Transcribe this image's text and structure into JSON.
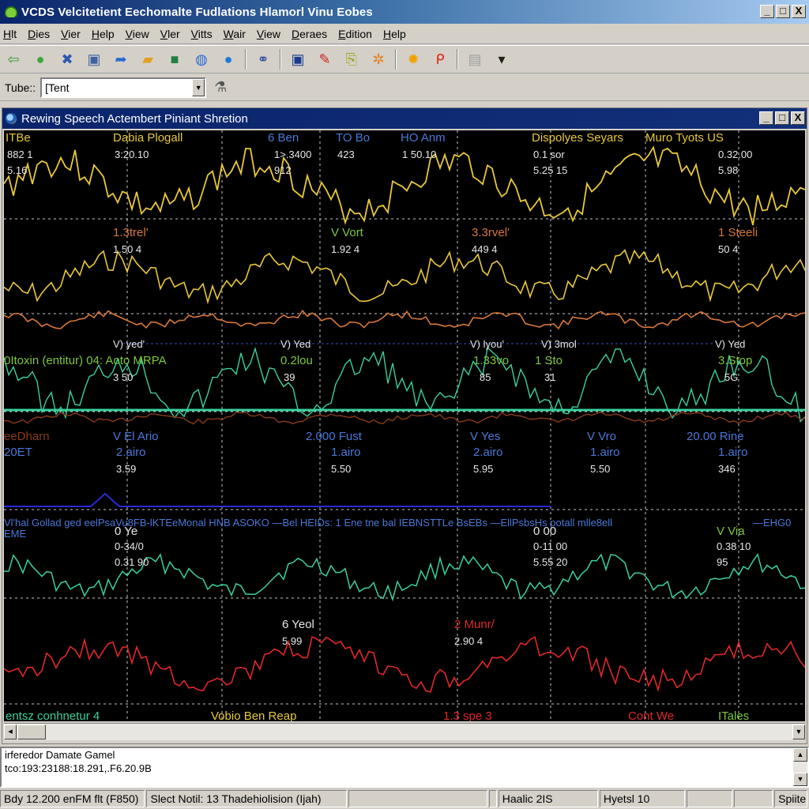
{
  "window": {
    "title": "VCDS  Velcitetient Eechomalte Fudlations Hlamorl Vinu Eobes",
    "controls": [
      "_",
      "□",
      "X"
    ]
  },
  "menubar": {
    "items": [
      "Hlt",
      "Dies",
      "Vier",
      "Help",
      "View",
      "Vler",
      "Vitts",
      "Wair",
      "View",
      "Deraes",
      "Edition",
      "Help"
    ]
  },
  "toolbar": {
    "buttons": [
      {
        "name": "back-arrow-icon",
        "glyph": "⇦",
        "color": "#3a9a3a"
      },
      {
        "name": "green-circle-icon",
        "glyph": "●",
        "color": "#3aa83a"
      },
      {
        "name": "tools-icon",
        "glyph": "✖",
        "color": "#2a5ab0"
      },
      {
        "name": "clipboard-icon",
        "glyph": "▣",
        "color": "#4060a0"
      },
      {
        "name": "pin-icon",
        "glyph": "➦",
        "color": "#2a6ad0"
      },
      {
        "name": "folder-icon",
        "glyph": "▰",
        "color": "#e0a020"
      },
      {
        "name": "monitor-icon",
        "glyph": "■",
        "color": "#208040"
      },
      {
        "name": "globe-icon",
        "glyph": "◍",
        "color": "#2a6ad0"
      },
      {
        "name": "blue-circle-icon",
        "glyph": "●",
        "color": "#1a7ad8"
      },
      {
        "name": "sep",
        "glyph": "",
        "color": ""
      },
      {
        "name": "link-icon",
        "glyph": "⚭",
        "color": "#3050a0"
      },
      {
        "name": "sep",
        "glyph": "",
        "color": ""
      },
      {
        "name": "document-icon",
        "glyph": "▣",
        "color": "#1a3a90"
      },
      {
        "name": "pen-icon",
        "glyph": "✎",
        "color": "#d02020"
      },
      {
        "name": "file-export-icon",
        "glyph": "⎘",
        "color": "#a0a020"
      },
      {
        "name": "gear-icon",
        "glyph": "✲",
        "color": "#e08020"
      },
      {
        "name": "sep",
        "glyph": "",
        "color": ""
      },
      {
        "name": "sun-icon",
        "glyph": "✹",
        "color": "#f0a000"
      },
      {
        "name": "hook-icon",
        "glyph": "ᑭ",
        "color": "#e03020"
      },
      {
        "name": "sep",
        "glyph": "",
        "color": ""
      },
      {
        "name": "window-layout-icon",
        "glyph": "▤",
        "color": "#a0a0a0"
      },
      {
        "name": "dropdown-arrow-icon",
        "glyph": "▾",
        "color": "#202020"
      }
    ]
  },
  "addressbar": {
    "label": "Tube::",
    "value": "[Tent",
    "placeholder": ""
  },
  "graph_window": {
    "title": "Rewing Speech Actembert Piniant Shretion",
    "controls": [
      "_",
      "□",
      "X"
    ]
  },
  "colors": {
    "yellow": "#e8c83a",
    "orange": "#d8783a",
    "brown": "#8a3a1a",
    "green_label": "#7ec83a",
    "cyan": "#3ad0a0",
    "blue_label": "#4a78d8",
    "blue_line": "#2a2ad8",
    "red": "#e02828",
    "white": "#e8e8e8"
  },
  "channels": {
    "row1": [
      {
        "label": "ITBe",
        "color": "yellow",
        "values": [
          "882 1",
          "5.16"
        ]
      },
      {
        "label": "Dabia Plogall",
        "color": "yellow",
        "values": [
          "3:20.10"
        ]
      },
      {
        "label": "6 Ben",
        "color": "blue_label",
        "values": [
          "1>.3400",
          "912"
        ]
      },
      {
        "label": "TO Bo",
        "color": "blue_label",
        "values": [
          "423"
        ]
      },
      {
        "label": "HO Anm",
        "color": "blue_label",
        "values": [
          "1 50.10"
        ]
      },
      {
        "label": "Dispolyes Seyars",
        "color": "yellow",
        "values": [
          "0.1 sor",
          "5.25 15"
        ]
      },
      {
        "label": "Muro Tyots US",
        "color": "yellow",
        "values": [
          "0.32.00",
          "5.98"
        ]
      }
    ],
    "row2": [
      {
        "label": "1.3trel'",
        "color": "orange",
        "values": [
          "1.50 4"
        ]
      },
      {
        "label": "V Vort",
        "color": "green_label",
        "values": [
          "1.92 4"
        ]
      },
      {
        "label": "3.3rvel'",
        "color": "orange",
        "values": [
          "449 4"
        ]
      },
      {
        "label": "1 Steeli",
        "color": "orange",
        "values": [
          "50 4"
        ]
      }
    ],
    "row3": [
      {
        "label": "V)  yed'",
        "color": "white",
        "values": []
      },
      {
        "label": "V)  Yed",
        "color": "white",
        "values": []
      },
      {
        "label": "V)  lyou'",
        "color": "white",
        "values": []
      },
      {
        "label": "V) 3mol",
        "color": "white",
        "values": []
      },
      {
        "label": "V)  Yed",
        "color": "white",
        "values": []
      }
    ],
    "row4": [
      {
        "label": "0Itoxin (entitur)  04: Aoto MRPA",
        "color": "green_label",
        "values": [
          "3 50"
        ]
      },
      {
        "label": "0.2lou",
        "color": "green_label",
        "values": [
          "39"
        ]
      },
      {
        "label": "1.33vo",
        "color": "green_label",
        "values": [
          "85"
        ]
      },
      {
        "label": "1 Sto",
        "color": "green_label",
        "values": [
          "31"
        ]
      },
      {
        "label": "3.Stop",
        "color": "green_label",
        "values": [
          "5G"
        ]
      }
    ],
    "row5": [
      {
        "label": "eeDharn",
        "color": "brown",
        "sub": "20ET",
        "values": []
      },
      {
        "label": "V  El Ario",
        "color": "blue_label",
        "sub": "2.airo",
        "values": [
          "3.59"
        ]
      },
      {
        "label": "2.000 Fust",
        "color": "blue_label",
        "sub": "1.airo",
        "values": [
          "5.50"
        ]
      },
      {
        "label": "V Yes",
        "color": "blue_label",
        "sub": "2.airo",
        "values": [
          "5.95"
        ]
      },
      {
        "label": "V Vro",
        "color": "blue_label",
        "sub": "1.airo",
        "values": [
          "5.50"
        ]
      },
      {
        "label": "20.00 Rine",
        "color": "blue_label",
        "sub": "1.airo",
        "values": [
          "346"
        ]
      }
    ],
    "row6_caption": "Vl'hal Gollad  ged eelPsaVu8FB-lKTEeMonal HNB ASOKO  —Bel HEIDs: 1 Ene tne bal IEBNSTTLe BsEBs  —EllPsbsHs potall mlle8ell",
    "row6_caption_right": "—EHG0",
    "row6_caption_sub": "EME",
    "row6": [
      {
        "label": "0 Ye",
        "color": "white",
        "values": [
          "0-34/0",
          "0.31 90"
        ]
      },
      {
        "label": "0 00",
        "color": "white",
        "values": [
          "0-11 00",
          "5.55 20"
        ]
      },
      {
        "label": "V Via",
        "color": "green_label",
        "values": [
          "0.38 10",
          "95"
        ]
      }
    ],
    "row7": [
      {
        "label": "6  Yeol",
        "color": "white",
        "values": [
          "5.99"
        ]
      },
      {
        "label": "2 Munr/",
        "color": "red",
        "values": [
          "2.90 4"
        ]
      }
    ],
    "bottom": [
      {
        "label": "entsz conhnetur 4",
        "color": "cyan"
      },
      {
        "label": "Vobio Ben Reap",
        "color": "yellow"
      },
      {
        "label": "1.3 spe    3",
        "color": "red"
      },
      {
        "label": "Cont We",
        "color": "red"
      },
      {
        "label": "ITales",
        "color": "green_label"
      }
    ]
  },
  "log": {
    "lines": [
      "irferedor Damate Gamel",
      "tco:193:23188:18.291,.F6.20.9B"
    ]
  },
  "statusbar": {
    "cells": [
      "Bdy 12.200 enFM flt (F850)",
      "Slect Notil: 13  Thadehiolision (Ijah)",
      "",
      "",
      "Haalic 2IS",
      "Hyetsl 10",
      "",
      "",
      "Spiite"
    ]
  }
}
